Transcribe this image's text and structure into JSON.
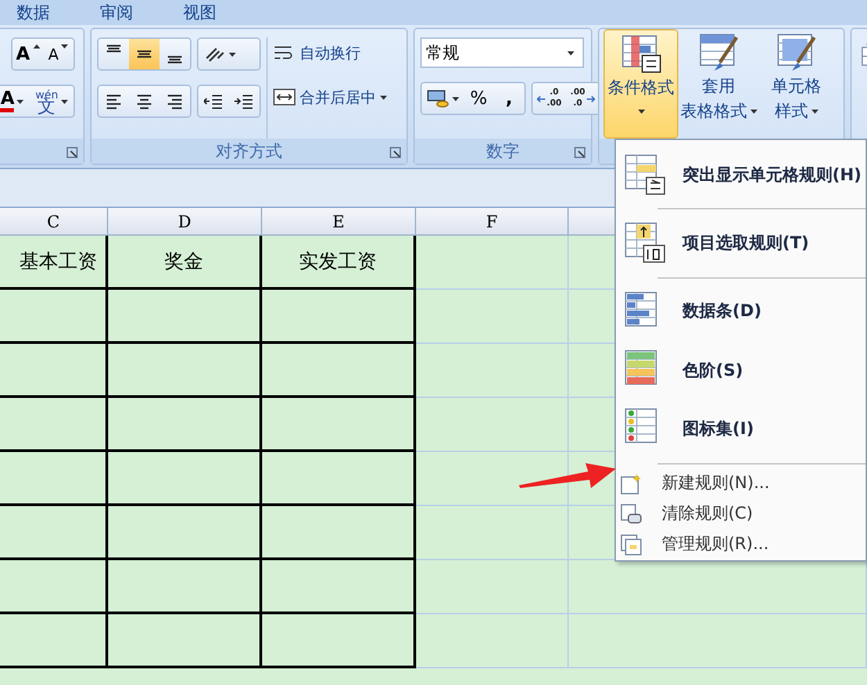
{
  "tabs": [
    {
      "label": "数据",
      "selected": false
    },
    {
      "label": "审阅",
      "selected": false
    },
    {
      "label": "视图",
      "selected": false
    }
  ],
  "font_group": {
    "buttons": [
      {
        "kind": "grow-font",
        "label": "A"
      },
      {
        "kind": "shrink-font",
        "label": "A"
      },
      {
        "kind": "font-color",
        "label": "A"
      },
      {
        "kind": "phonetic",
        "label": "文",
        "ruby": "wén"
      }
    ]
  },
  "alignment_group": {
    "label": "对齐方式",
    "vertical_align": [
      {
        "kind": "top",
        "selected": false
      },
      {
        "kind": "middle",
        "selected": true
      },
      {
        "kind": "bottom",
        "selected": false
      }
    ],
    "horizontal_align": [
      {
        "kind": "left",
        "selected": false
      },
      {
        "kind": "center",
        "selected": false
      },
      {
        "kind": "right",
        "selected": false
      }
    ],
    "wrap_text": "自动换行",
    "merge_center": "合并后居中"
  },
  "number_group": {
    "label": "数字",
    "format": "常规",
    "percent": "%",
    "comma": ",",
    "increase_decimal": [
      ".0",
      ".00"
    ],
    "decrease_decimal": [
      ".00",
      ".0"
    ]
  },
  "styles_group": {
    "buttons": [
      {
        "kind": "conditional",
        "lines": [
          "条件格式"
        ],
        "selected": true
      },
      {
        "kind": "table",
        "lines": [
          "套用",
          "表格格式"
        ],
        "selected": false
      },
      {
        "kind": "cell",
        "lines": [
          "单元格",
          "样式"
        ],
        "selected": false
      }
    ]
  },
  "sheet": {
    "columns": [
      "C",
      "D",
      "E",
      "F",
      ""
    ],
    "header": [
      "基本工资",
      "奖金",
      "实发工资"
    ]
  },
  "menu": {
    "items": [
      {
        "kind": "highlight",
        "label": "突出显示单元格规则(H)"
      },
      {
        "kind": "top-bottom",
        "label": "项目选取规则(T)"
      },
      {
        "kind": "data-bars",
        "label": "数据条(D)"
      },
      {
        "kind": "color-scales",
        "label": "色阶(S)"
      },
      {
        "kind": "icon-sets",
        "label": "图标集(I)"
      },
      {
        "kind": "new-rule",
        "label": "新建规则(N)..."
      },
      {
        "kind": "clear-rules",
        "label": "清除规则(C)"
      },
      {
        "kind": "manage-rules",
        "label": "管理规则(R)..."
      }
    ]
  }
}
